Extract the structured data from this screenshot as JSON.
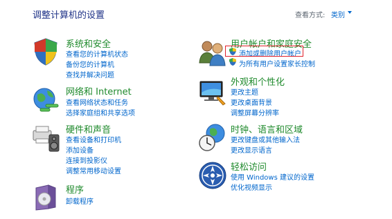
{
  "header": {
    "title": "调整计算机的设置",
    "view_by_label": "查看方式:",
    "view_by_value": "类别"
  },
  "categories": [
    {
      "icon": "system-security-icon",
      "title": "系统和安全",
      "links": [
        "查看您的计算机状态",
        "备份您的计算机",
        "查找并解决问题"
      ]
    },
    {
      "icon": "network-icon",
      "title": "网络和 Internet",
      "links": [
        "查看网络状态和任务",
        "选择家庭组和共享选项"
      ]
    },
    {
      "icon": "hardware-sound-icon",
      "title": "硬件和声音",
      "links": [
        "查看设备和打印机",
        "添加设备",
        "连接到投影仪",
        "调整常用移动设置"
      ]
    },
    {
      "icon": "programs-icon",
      "title": "程序",
      "links": [
        "卸载程序"
      ]
    },
    {
      "icon": "user-accounts-icon",
      "title": "用户帐户和家庭安全",
      "links": [
        "添加或删除用户帐户",
        "为所有用户设置家长控制"
      ]
    },
    {
      "icon": "appearance-icon",
      "title": "外观和个性化",
      "links": [
        "更改主题",
        "更改桌面背景",
        "调整屏幕分辨率"
      ]
    },
    {
      "icon": "clock-region-icon",
      "title": "时钟、语言和区域",
      "links": [
        "更改键盘或其他输入法",
        "更改显示语言"
      ]
    },
    {
      "icon": "ease-of-access-icon",
      "title": "轻松访问",
      "links": [
        "使用 Windows 建议的设置",
        "优化视频显示"
      ]
    }
  ],
  "colors": {
    "heading_green": "#1f8a2c",
    "link_blue": "#0066cc",
    "title_blue": "#1e3287",
    "highlight_red": "#e0202a"
  }
}
